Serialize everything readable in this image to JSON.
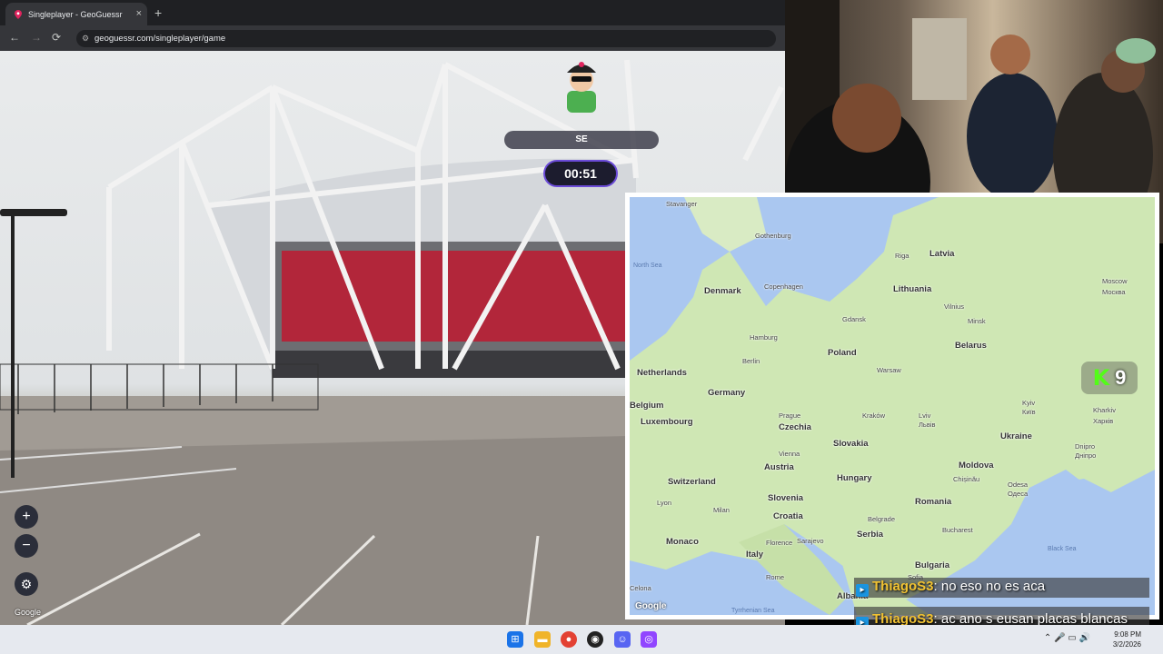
{
  "browser": {
    "tab_title": "Singleplayer - GeoGuessr",
    "tab_close": "×",
    "new_tab": "+",
    "back": "←",
    "forward": "→",
    "reload": "⟳",
    "url": "geoguessr.com/singleplayer/game"
  },
  "game": {
    "compass_heading": "SE",
    "timer": "00:51",
    "zoom_in": "+",
    "zoom_out": "−",
    "settings_icon": "gear-icon",
    "google_logo": "Google"
  },
  "map": {
    "google_logo": "Google",
    "countries": [
      {
        "name": "Latvia"
      },
      {
        "name": "Lithuania"
      },
      {
        "name": "Denmark"
      },
      {
        "name": "Belarus"
      },
      {
        "name": "Poland"
      },
      {
        "name": "Netherlands"
      },
      {
        "name": "Germany"
      },
      {
        "name": "Belgium"
      },
      {
        "name": "Luxembourg"
      },
      {
        "name": "Czechia"
      },
      {
        "name": "Slovakia"
      },
      {
        "name": "Ukraine"
      },
      {
        "name": "Austria"
      },
      {
        "name": "Moldova"
      },
      {
        "name": "Switzerland"
      },
      {
        "name": "Hungary"
      },
      {
        "name": "Slovenia"
      },
      {
        "name": "Romania"
      },
      {
        "name": "Croatia"
      },
      {
        "name": "Serbia"
      },
      {
        "name": "Monaco"
      },
      {
        "name": "Italy"
      },
      {
        "name": "Bulgaria"
      },
      {
        "name": "Albania"
      }
    ],
    "cities": [
      "Stavanger",
      "Gothenburg",
      "Riga",
      "Copenhagen",
      "Vilnius",
      "Gdansk",
      "Minsk",
      "Hamburg",
      "Berlin",
      "Warsaw",
      "Moscow",
      "Москва",
      "Kyiv",
      "Київ",
      "Kharkiv",
      "Харків",
      "Prague",
      "Kraków",
      "Lviv",
      "Львів",
      "Vienna",
      "Dnipro",
      "Дніпро",
      "Chișinău",
      "Odesa",
      "Одеса",
      "Lyon",
      "Milan",
      "Belgrade",
      "Bucharest",
      "Florence",
      "Sarajevo",
      "Rome",
      "Sofia",
      "Celona"
    ],
    "seas": [
      "North Sea",
      "Black Sea",
      "Tyrrhenian Sea"
    ]
  },
  "overlay": {
    "kick_logo": "K",
    "viewer_count": "9"
  },
  "chat": [
    {
      "user": "ThiagoS3",
      "message": ": no eso no es aca"
    },
    {
      "user": "ThiagoS3",
      "message": ": ac ano s eusan placas blancas"
    }
  ],
  "taskbar": {
    "clock_time": "9:08 PM",
    "clock_date": "3/2/2026"
  },
  "colors": {
    "accent_timer": "#6b4bd8",
    "kick_green": "#53fc18",
    "chat_user": "#f1c232"
  }
}
